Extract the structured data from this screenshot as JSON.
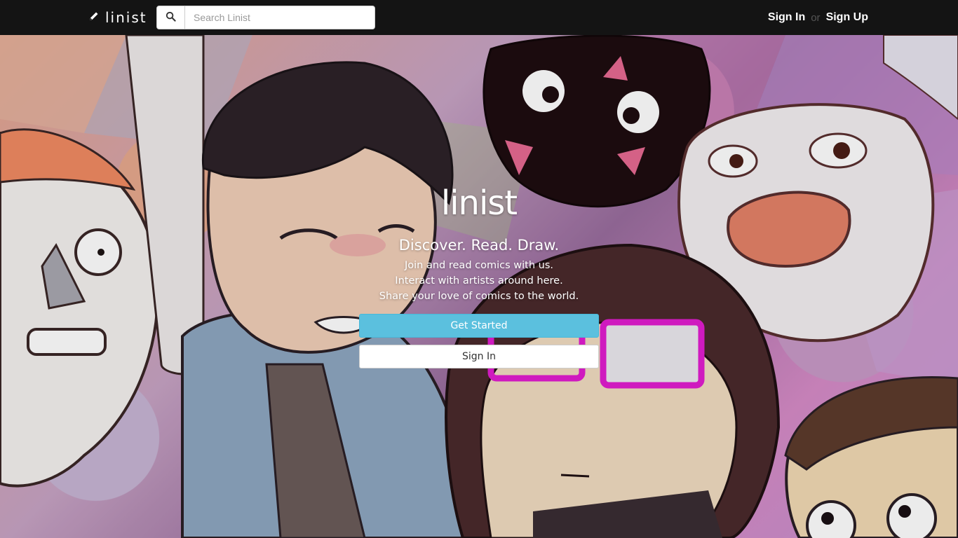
{
  "navbar": {
    "brand": "linist",
    "search_placeholder": "Search Linist",
    "sign_in": "Sign In",
    "or": "or",
    "sign_up": "Sign Up"
  },
  "hero": {
    "logo": "linist",
    "tagline": "Discover. Read. Draw.",
    "lines": [
      "Join and read comics with us.",
      "Interact with artists around here.",
      "Share your love of comics to the world."
    ],
    "get_started": "Get Started",
    "sign_in": "Sign In"
  },
  "colors": {
    "navbar_bg": "#141414",
    "primary_button": "#5bc0de",
    "text_light": "#ffffff"
  },
  "icons": {
    "brand": "pencil-icon",
    "search": "search-icon"
  }
}
